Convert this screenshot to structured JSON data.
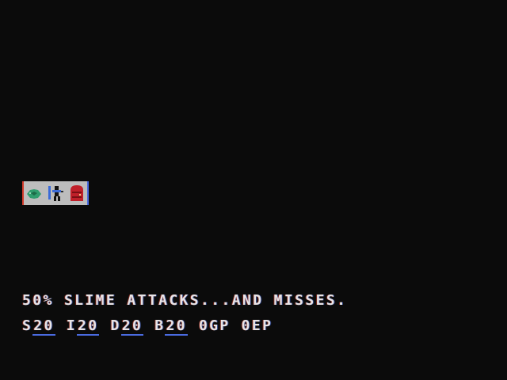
{
  "message": "50% SLIME ATTACKS...AND MISSES.",
  "stats": {
    "strength_label": "S",
    "strength_value": "20",
    "intelligence_label": "I",
    "intelligence_value": "20",
    "dexterity_label": "D",
    "dexterity_value": "20",
    "body_label": "B",
    "body_value": "20",
    "gold": "0GP",
    "experience": "0EP"
  },
  "tiles": [
    {
      "icon": "slime-icon",
      "color": "#2f9d6e"
    },
    {
      "icon": "player-icon",
      "color": "#3a6ad8"
    },
    {
      "icon": "door-icon",
      "color": "#c0202a"
    }
  ],
  "colors": {
    "background": "#0b0b0b",
    "text": "#e8e4e6",
    "tile_background": "#bdbdbd"
  }
}
